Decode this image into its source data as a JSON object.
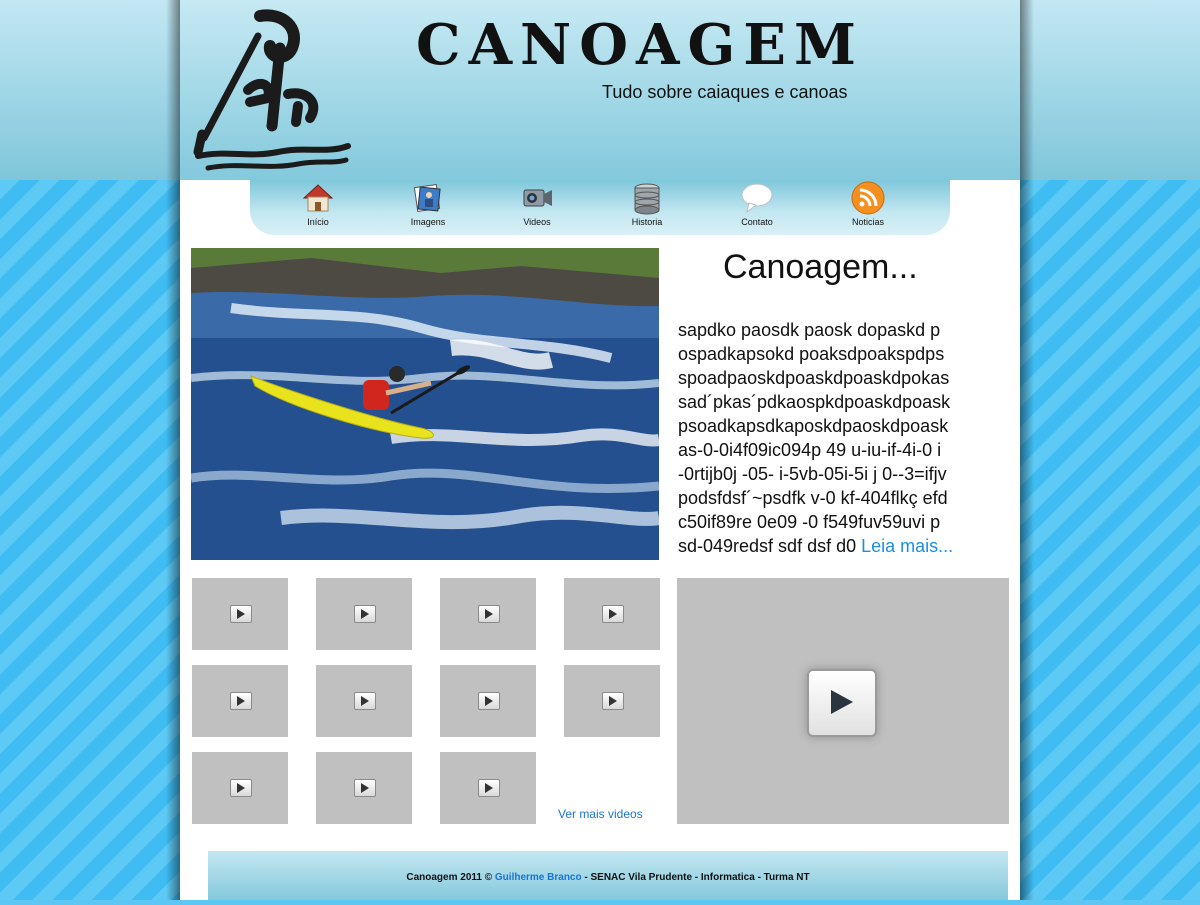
{
  "header": {
    "brand": "CANOAGEM",
    "tagline": "Tudo sobre caiaques e canoas"
  },
  "nav": {
    "items": [
      {
        "label": "Início",
        "icon": "home-icon"
      },
      {
        "label": "Imagens",
        "icon": "photos-icon"
      },
      {
        "label": "Videos",
        "icon": "camcorder-icon"
      },
      {
        "label": "Historia",
        "icon": "database-icon"
      },
      {
        "label": "Contato",
        "icon": "speech-bubble-icon"
      },
      {
        "label": "Noticias",
        "icon": "rss-icon"
      }
    ]
  },
  "article": {
    "title": "Canoagem...",
    "body": "sapdko paosdk paosk dopaskd p\nospadkapsokd poaksdpoakspdps\nspoadpaoskdpoaskdpoaskdpokas\nsad´pkas´pdkaospkdpoaskdpoask\npsoadkapsdkaposkdpaoskdpoask\nas-0-0i4f09ic094p 49 u-iu-if-4i-0 i\n-0rtijb0j -05- i-5vb-05i-5i j 0--3=ifjv\npodsfdsf´~psdfk v-0 kf-404flkç efd\nc50if89re 0e09  -0 f549fuv59uvi p\nsd-049redsf sdf dsf  d0 ",
    "read_more": "Leia mais..."
  },
  "videos": {
    "thumbnail_count": 11,
    "see_more": "Ver mais videos"
  },
  "footer": {
    "prefix": "Canoagem 2011 © ",
    "author": "Guilherme Branco",
    "suffix": " - SENAC Vila Prudente - Informatica - Turma NT"
  },
  "colors": {
    "accent_link": "#1a73d9",
    "header_gradient_top": "#c6e9f3",
    "header_gradient_bottom": "#83c9dc",
    "stripe_blue": "#5dcaf6",
    "thumb_gray": "#c0c0c0"
  }
}
